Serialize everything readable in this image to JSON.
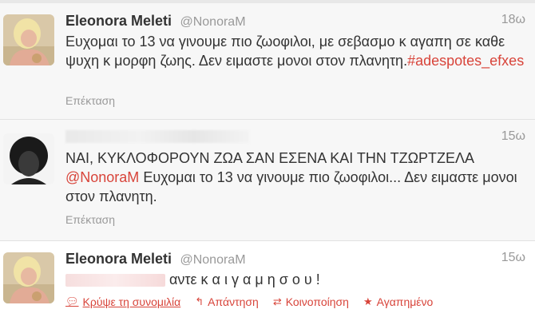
{
  "tweets": [
    {
      "name": "Eleonora Meleti",
      "handle": "@NonoraM",
      "time": "18ω",
      "text": "Ευχομαι το 13 να γινουμε πιο ζωοφιλοι, με σεβασμο κ αγαπη σε καθε ψυχη κ μορφη ζωης. Δεν ειμαστε μονοι στον πλανητη.",
      "hashtag": "#adespotes_efxes",
      "expand": "Επέκταση"
    },
    {
      "time": "15ω",
      "text_line1": "ΝΑΙ, ΚΥΚΛΟΦΟΡΟΥΝ ΖΩΑ ΣΑΝ ΕΣΕΝΑ ΚΑΙ ΤΗΝ ΤΖΩΡΤΖΕΛΑ",
      "mention": "@NonoraM",
      "text_line2": " Ευχομαι το 13 να γινουμε πιο ζωοφιλοι... Δεν ειμαστε μονοι στον πλανητη.",
      "expand": "Επέκταση"
    },
    {
      "name": "Eleonora Meleti",
      "handle": "@NonoraM",
      "time": "15ω",
      "text": "αντε κ α ι γ α μ η σ ο υ !",
      "actions": {
        "hide": "Κρύψε τη συνομιλία",
        "reply": "Απάντηση",
        "retweet": "Κοινοποίηση",
        "favorite": "Αγαπημένο"
      }
    }
  ],
  "colors": {
    "accent": "#d8443a",
    "muted": "#999999",
    "text": "#333333"
  },
  "icons": [
    "conversation-icon",
    "reply-icon",
    "retweet-icon",
    "favorite-icon"
  ]
}
